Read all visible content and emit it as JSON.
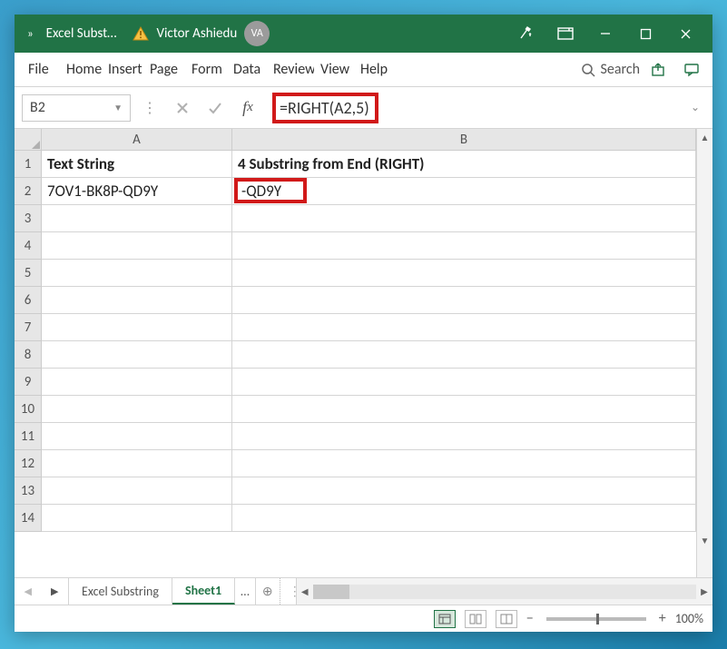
{
  "title_bar": {
    "document_name": "Excel Subst…",
    "user_name": "Victor Ashiedu",
    "user_initials": "VA"
  },
  "menu": {
    "items": [
      "File",
      "Home",
      "Insert",
      "Page",
      "Form",
      "Data",
      "Review",
      "View",
      "Help"
    ],
    "search_label": "Search"
  },
  "formula_bar": {
    "cell_ref": "B2",
    "formula": "=RIGHT(A2,5)"
  },
  "columns": [
    "A",
    "B"
  ],
  "row_numbers": [
    1,
    2,
    3,
    4,
    5,
    6,
    7,
    8,
    9,
    10,
    11,
    12,
    13,
    14
  ],
  "cells": {
    "A1": "Text String",
    "B1": "4 Substring from End (RIGHT)",
    "A2": "7OV1-BK8P-QD9Y",
    "B2": "-QD9Y"
  },
  "tabs": {
    "inactive": "Excel Substring",
    "active": "Sheet1"
  },
  "status": {
    "zoom": "100%"
  },
  "colors": {
    "brand": "#217346",
    "highlight": "#d11919"
  }
}
